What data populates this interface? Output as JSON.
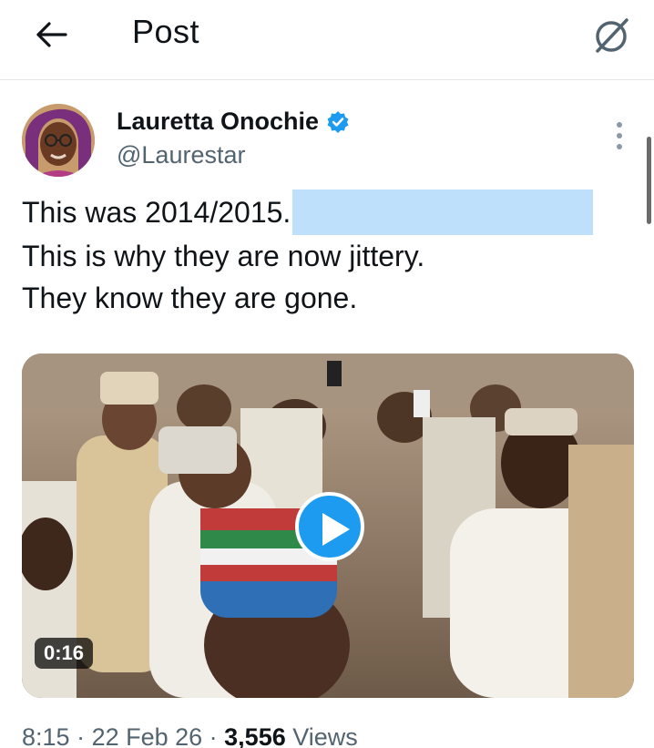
{
  "header": {
    "title": "Post",
    "back_icon": "arrow-left-icon",
    "grok_icon": "grok-icon"
  },
  "author": {
    "name": "Lauretta Onochie",
    "handle": "@Laurestar",
    "verified": true,
    "verified_color": "#1d9bf0"
  },
  "tweet": {
    "line1": "This was 2014/2015.",
    "line2": "This is why they are now jittery.",
    "line3": "They know they are gone."
  },
  "media": {
    "type": "video",
    "duration": "0:16",
    "play_icon": "play-icon"
  },
  "meta": {
    "time": "8:15",
    "sep1": " · ",
    "date": "22 Feb 26",
    "sep2": " · ",
    "views_count": "3,556",
    "views_label": " Views"
  },
  "colors": {
    "accent": "#1d9bf0",
    "text_primary": "#0f1419",
    "text_secondary": "#536471",
    "redaction": "#bfe0fa"
  }
}
